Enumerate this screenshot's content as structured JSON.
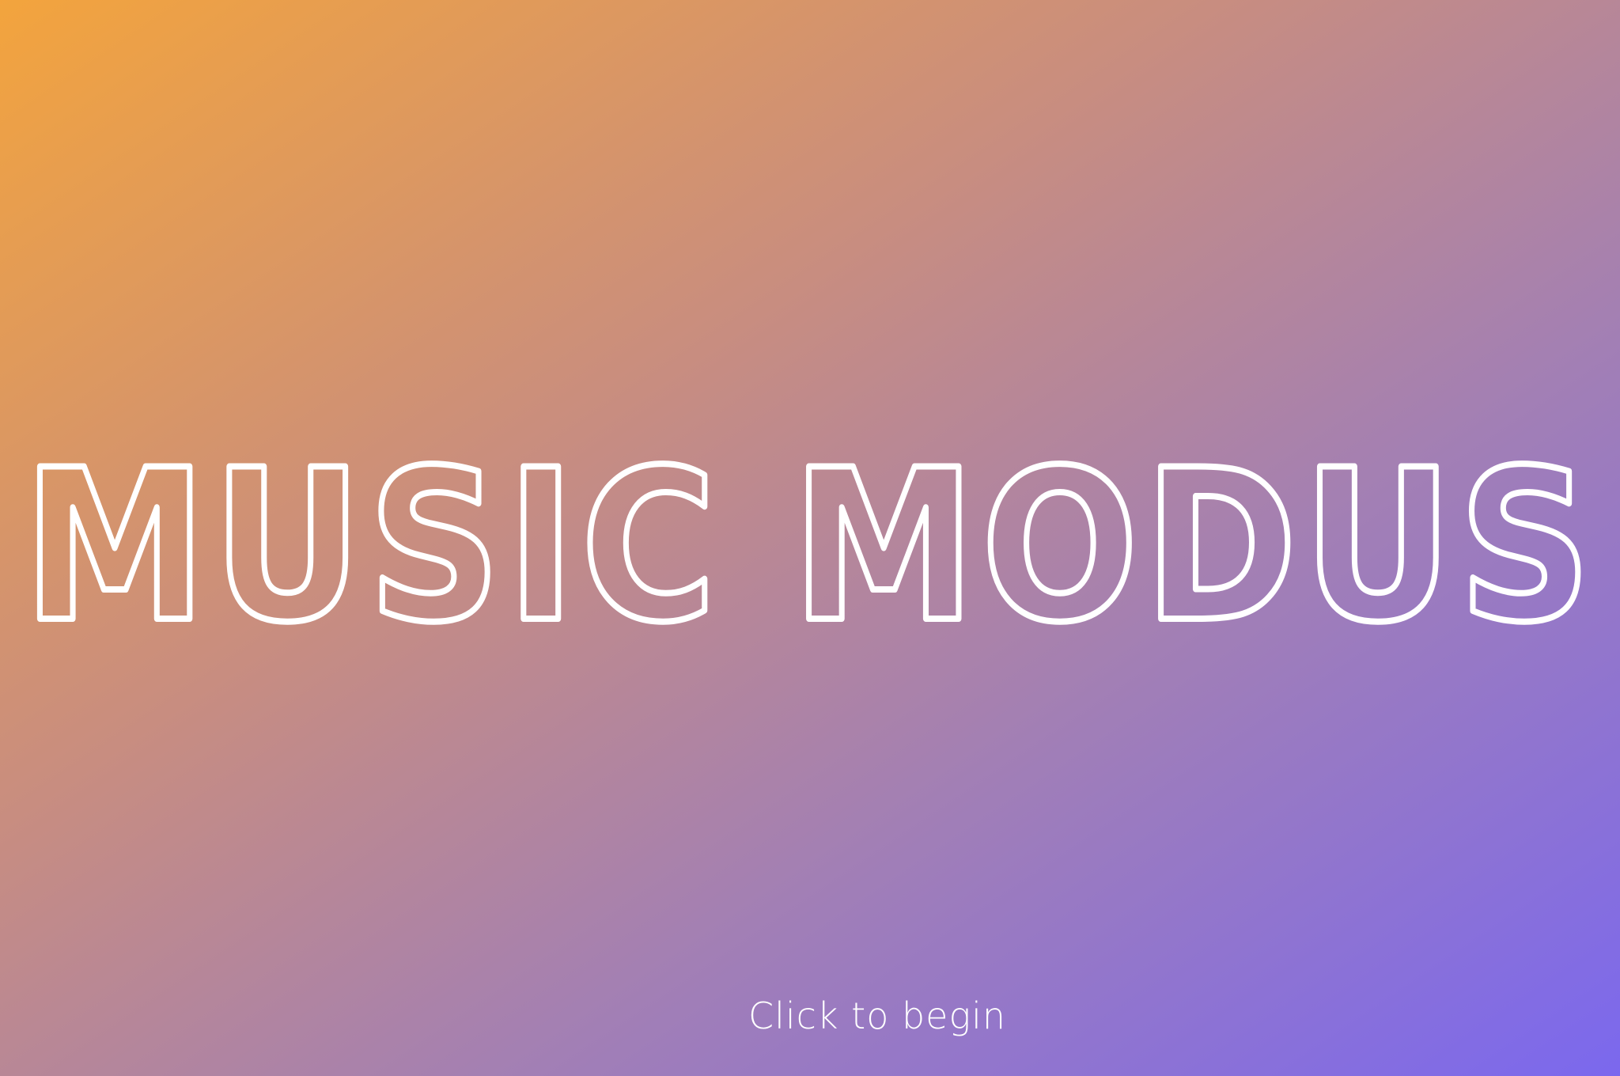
{
  "app": {
    "title": "MUSIC MODUS"
  },
  "start": {
    "label": "Click to begin"
  },
  "colors": {
    "gradient_start": "#f3a43d",
    "gradient_mid": "#c88d80",
    "gradient_end": "#7b68ee",
    "text": "#ffffff"
  }
}
